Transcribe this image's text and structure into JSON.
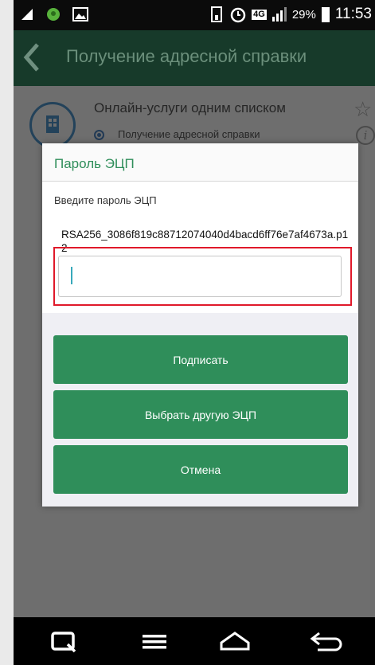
{
  "status_bar": {
    "battery": "29%",
    "time": "11:53",
    "network": "4G"
  },
  "app_bar": {
    "title": "Получение адресной справки"
  },
  "service": {
    "title": "Онлайн-услуги одним списком",
    "subtitle": "Получение адресной справки"
  },
  "dialog": {
    "title": "Пароль ЭЦП",
    "prompt": "Введите пароль ЭЦП",
    "key_file": "RSA256_3086f819c88712074040d4bacd6ff76e7af4673a.p12",
    "password_value": "",
    "buttons": {
      "sign": "Подписать",
      "choose_other": "Выбрать другую ЭЦП",
      "cancel": "Отмена"
    }
  },
  "colors": {
    "accent": "#2f8e5a",
    "app_bar": "#173a2a",
    "highlight": "#e0192a"
  }
}
